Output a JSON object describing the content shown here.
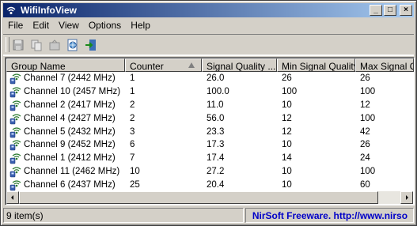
{
  "window": {
    "title": "WifiInfoView"
  },
  "title_buttons": {
    "minimize": "_",
    "maximize": "□",
    "close": "×"
  },
  "menu": [
    "File",
    "Edit",
    "View",
    "Options",
    "Help"
  ],
  "toolbar": [
    "save-icon",
    "copy-icon",
    "properties-icon",
    "html-report-icon",
    "exit-icon"
  ],
  "table": {
    "columns": [
      "Group Name",
      "Counter",
      "Signal Quality ...",
      "Min Signal Quality",
      "Max Signal Qu"
    ],
    "sort_column": "Counter",
    "rows": [
      [
        "Channel 7  (2442 MHz)",
        "1",
        "26.0",
        "26",
        "26"
      ],
      [
        "Channel 10  (2457 MHz)",
        "1",
        "100.0",
        "100",
        "100"
      ],
      [
        "Channel 2  (2417 MHz)",
        "2",
        "11.0",
        "10",
        "12"
      ],
      [
        "Channel 4  (2427 MHz)",
        "2",
        "56.0",
        "12",
        "100"
      ],
      [
        "Channel 5  (2432 MHz)",
        "3",
        "23.3",
        "12",
        "42"
      ],
      [
        "Channel 9  (2452 MHz)",
        "6",
        "17.3",
        "10",
        "26"
      ],
      [
        "Channel 1  (2412 MHz)",
        "7",
        "17.4",
        "14",
        "24"
      ],
      [
        "Channel 11  (2462 MHz)",
        "10",
        "27.2",
        "10",
        "100"
      ],
      [
        "Channel 6  (2437 MHz)",
        "25",
        "20.4",
        "10",
        "60"
      ]
    ]
  },
  "status": {
    "items": "9 item(s)",
    "credit": "NirSoft Freeware.  http://www.nirso"
  },
  "colors": {
    "title_start": "#0a246a",
    "title_end": "#a6caf0",
    "credit": "#0000c8"
  }
}
